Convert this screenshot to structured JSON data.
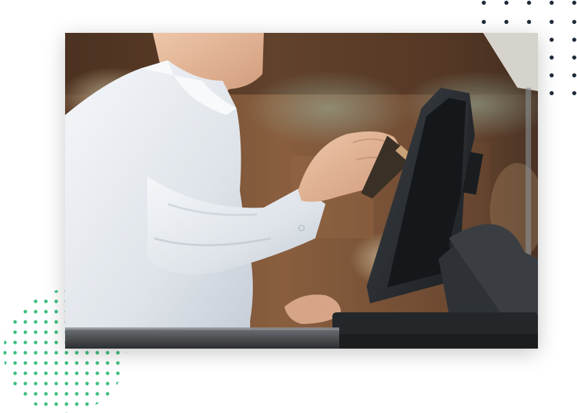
{
  "image": {
    "subject": "",
    "colors": {
      "background_warm": "#7a5236",
      "background_dark": "#3f2a1c",
      "shirt": "#e9edf2",
      "skin": "#e3b79a",
      "terminal": "#2b2f33",
      "counter": "#4b4e52"
    }
  },
  "decorations": {
    "dark_dots_color": "#1f2b3a",
    "green_dots_color": "#3fbf7f"
  }
}
